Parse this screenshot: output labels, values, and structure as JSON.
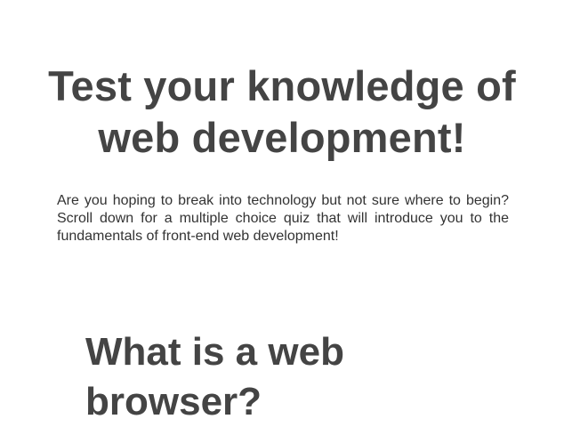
{
  "header": {
    "title": "Test your knowledge of web development!"
  },
  "intro": {
    "text": "Are you hoping to break into technology but not sure where to begin? Scroll down for a multiple choice quiz that will introduce you to the fundamentals of front-end web development!"
  },
  "quiz": {
    "question_title": "What is a web browser?"
  },
  "colors": {
    "text_dark": "#444444",
    "background": "#ffffff"
  }
}
